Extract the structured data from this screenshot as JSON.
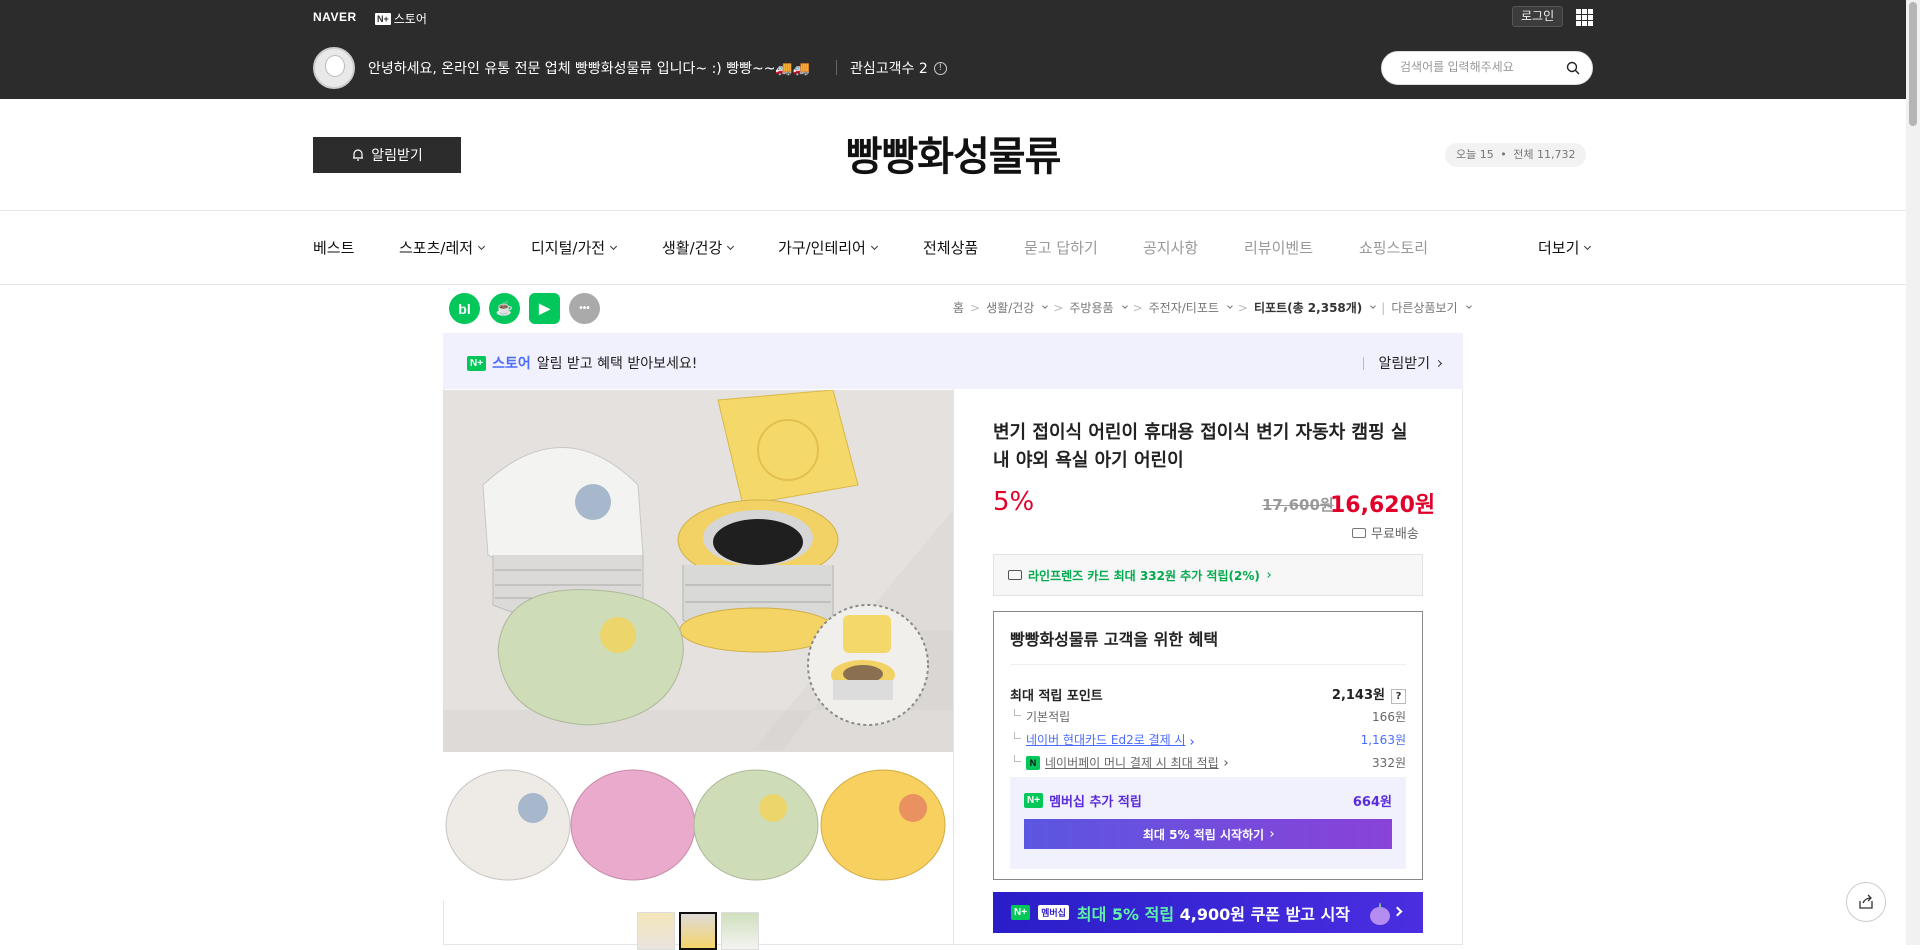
{
  "top_bar": {
    "naver_label": "NAVER",
    "nplus_badge": "N+",
    "nplus_store_label": "스토어",
    "login_label": "로그인",
    "apps_icon": "grid-icon"
  },
  "seller": {
    "message": "안녕하세요, 온라인 유통 전문 업체 빵빵화성물류 입니다~ :) 빵빵~~🚚🚚",
    "fans_label": "관심고객수 2",
    "info_icon": "info-icon"
  },
  "search": {
    "placeholder": "검색어를 입력해주세요",
    "icon": "search-icon"
  },
  "header": {
    "notify_label": "알림받기",
    "store_name": "빵빵화성물류",
    "visitors_today": "오늘 15",
    "visitors_total": "전체 11,732"
  },
  "nav": {
    "items": [
      {
        "label": "베스트"
      },
      {
        "label": "스포츠/레저"
      },
      {
        "label": "디지털/가전"
      },
      {
        "label": "생활/건강"
      },
      {
        "label": "가구/인테리어"
      },
      {
        "label": "전체상품"
      },
      {
        "label": "묻고 답하기"
      },
      {
        "label": "공지사항"
      },
      {
        "label": "리뷰이벤트"
      },
      {
        "label": "쇼핑스토리"
      }
    ],
    "more_label": "더보기"
  },
  "share_icons": [
    {
      "label": "bl",
      "color": "#03c75a"
    },
    {
      "label": "☕",
      "color": "#03c75a"
    },
    {
      "label": "▶",
      "color": "#03c75a"
    },
    {
      "label": "•••",
      "color": "#aaaaaa"
    }
  ],
  "breadcrumb": {
    "home": "홈",
    "c1": "생활/건강",
    "c2": "주방용품",
    "c3": "주전자/티포트",
    "c4": "티포트(총 2,358개)",
    "other": "다른상품보기"
  },
  "banner": {
    "badge": "N+",
    "store": "스토어",
    "text": "알림 받고 혜택 받아보세요!",
    "action": "알림받기"
  },
  "product": {
    "title": "변기 접이식 어린이 휴대용 접이식 변기 자동차 캠핑 실내 야외 욕실 아기 어린이",
    "discount": "5%",
    "original_price": "17,600원",
    "sale_price": "16,620원",
    "shipping": "무료배송",
    "card_benefit": "라인프렌즈 카드 최대 332원 추가 적립(2%)"
  },
  "benefits": {
    "title": "빵빵화성물류 고객을 위한 혜택",
    "max_label": "최대 적립 포인트",
    "max_value": "2,143원",
    "rows": [
      {
        "label": "기본적립",
        "value": "166원"
      },
      {
        "label": "네이버 현대카드 Ed2로 결제 시",
        "value": "1,163원"
      },
      {
        "label": "네이버페이 머니 결제 시 최대 적립",
        "value": "332원"
      }
    ],
    "npay_icon_text": "N",
    "membership_label": "멤버십 추가 적립",
    "membership_value": "664원",
    "membership_button": "최대 5% 적립 시작하기"
  },
  "promo": {
    "badge": "N+",
    "tag": "멤버십",
    "text_accent": "최대 5% 적립",
    "text_rest": "4,900원 쿠폰 받고 시작"
  },
  "colors": {
    "topbar": "#2c2c2c",
    "accent_red": "#e0002a",
    "naver_green": "#03c75a",
    "membership_purple": "#5b56e0"
  }
}
